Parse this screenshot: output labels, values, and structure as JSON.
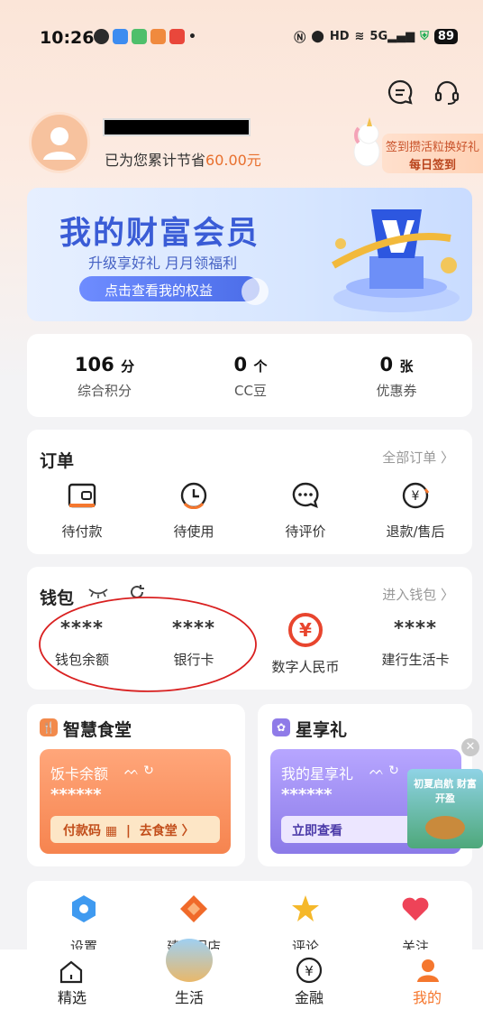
{
  "status_bar": {
    "time": "10:26",
    "battery": "89",
    "net": "5G"
  },
  "profile": {
    "saved_prefix": "已为您累计节省",
    "saved_amount": "60.00元"
  },
  "sign": {
    "promo": "签到攒活粒换好礼",
    "daily": "每日签到"
  },
  "banner": {
    "title": "我的财富会员",
    "subtitle": "升级享好礼 月月领福利",
    "button": "点击查看我的权益"
  },
  "stats": [
    {
      "value": "106",
      "unit": "分",
      "label": "综合积分"
    },
    {
      "value": "0",
      "unit": "个",
      "label": "CC豆"
    },
    {
      "value": "0",
      "unit": "张",
      "label": "优惠券"
    }
  ],
  "orders": {
    "title": "订单",
    "link": "全部订单",
    "items": [
      "待付款",
      "待使用",
      "待评价",
      "退款/售后"
    ]
  },
  "wallet": {
    "title": "钱包",
    "link": "进入钱包",
    "items": [
      {
        "value": "****",
        "label": "钱包余额"
      },
      {
        "value": "****",
        "label": "银行卡"
      },
      {
        "value": "",
        "label": "数字人民币"
      },
      {
        "value": "****",
        "label": "建行生活卡"
      }
    ]
  },
  "canteen": {
    "title": "智慧食堂",
    "card_title": "饭卡余额",
    "masked": "******",
    "pay": "付款码",
    "go": "去食堂"
  },
  "xing": {
    "title": "星享礼",
    "card_title": "我的星享礼",
    "masked": "******",
    "button": "立即查看",
    "float_text": "初夏启航 财富开盈"
  },
  "shortcuts": [
    "设置",
    "建行门店",
    "评论",
    "关注"
  ],
  "tabs": [
    "精选",
    "生活",
    "金融",
    "我的"
  ],
  "colors": {
    "accent": "#f5772e",
    "wallet_circle": "#e8452e"
  }
}
